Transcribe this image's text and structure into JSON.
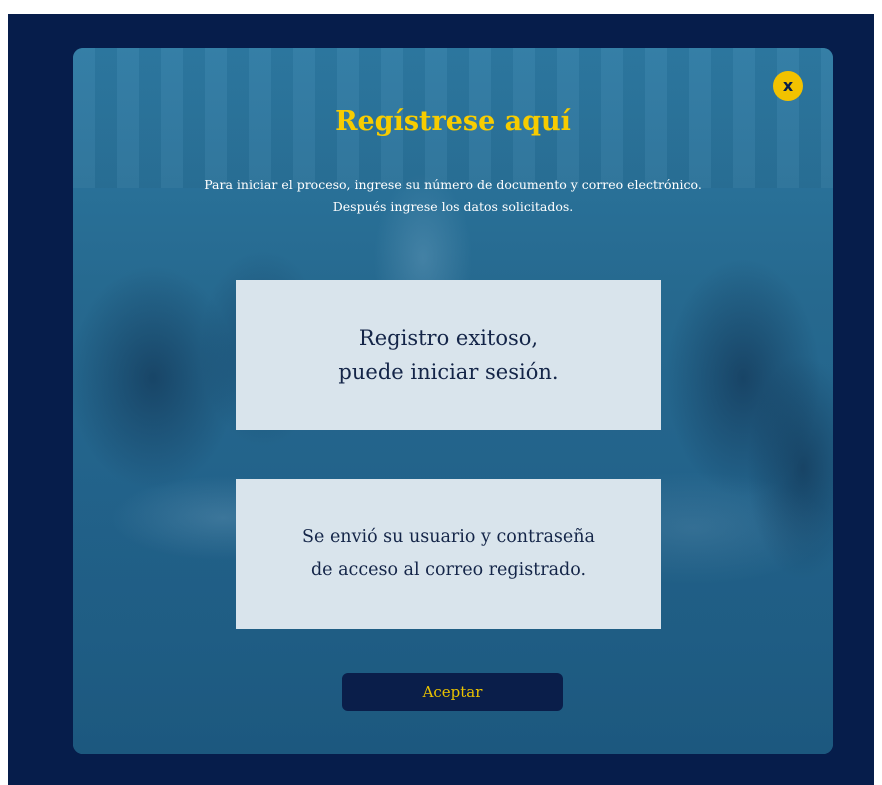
{
  "modal": {
    "close_label": "x",
    "title": "Regístrese aquí",
    "subtitle_lines": [
      "Para iniciar el proceso, ingrese su número de documento y correo electrónico.",
      "Después ingrese los datos solicitados."
    ],
    "success_card": {
      "lines": [
        "Registro exitoso,",
        "puede iniciar sesión."
      ]
    },
    "email_card": {
      "lines": [
        "Se envió su usuario y contraseña",
        "de acceso al correo registrado."
      ]
    },
    "accept_label": "Aceptar"
  },
  "colors": {
    "backdrop": "#061d4b",
    "modal_overlay": "#25668e",
    "accent_yellow": "#f7cc00",
    "button_dark": "#0a1e4a",
    "card_bg": "#d9e4ec"
  },
  "icons": {
    "close": "close-icon"
  }
}
